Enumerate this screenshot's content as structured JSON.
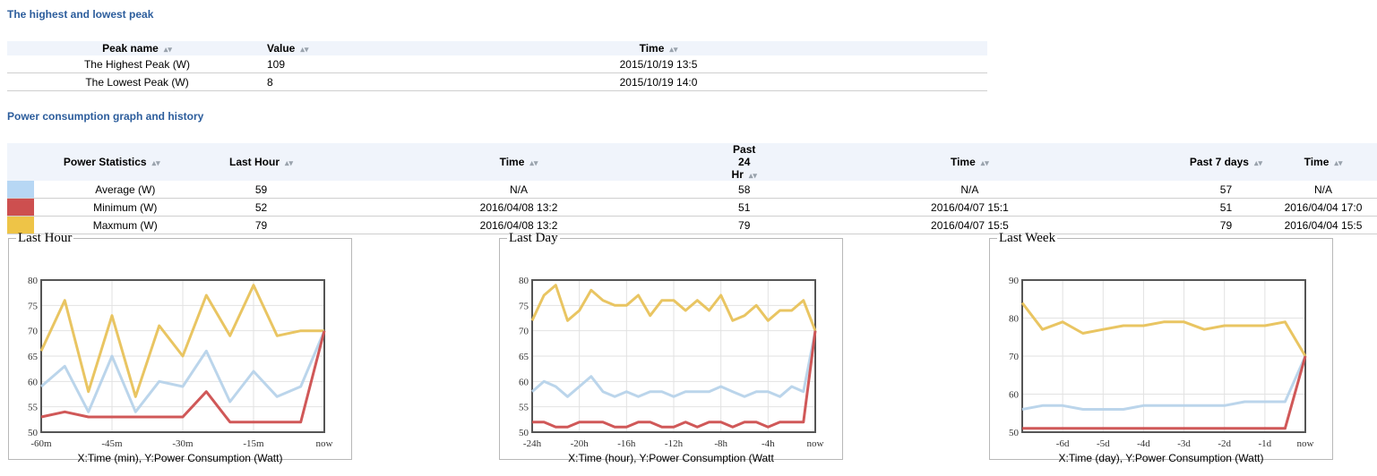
{
  "peak_section": {
    "title": "The highest and lowest peak",
    "headers": [
      "Peak name",
      "Value",
      "Time"
    ],
    "rows": [
      {
        "name": "The Highest Peak (W)",
        "value": "109",
        "time": "2015/10/19 13:5"
      },
      {
        "name": "The Lowest Peak (W)",
        "value": "8",
        "time": "2015/10/19 14:0"
      }
    ]
  },
  "power_section": {
    "title": "Power consumption graph and history",
    "headers": [
      "Power Statistics",
      "Last Hour",
      "Time",
      "Past 24 Hr",
      "Time",
      "Past 7 days",
      "Time"
    ],
    "rows": [
      {
        "swatch": "#b7d7f4",
        "label": "Average (W)",
        "cells": [
          "59",
          "N/A",
          "58",
          "N/A",
          "57",
          "N/A"
        ]
      },
      {
        "swatch": "#cd4f4f",
        "label": "Minimum (W)",
        "cells": [
          "52",
          "2016/04/08 13:2",
          "51",
          "2016/04/07 15:1",
          "51",
          "2016/04/04 17:0"
        ]
      },
      {
        "swatch": "#eec447",
        "label": "Maxmum (W)",
        "cells": [
          "79",
          "2016/04/08 13:2",
          "79",
          "2016/04/07 15:5",
          "79",
          "2016/04/04 15:5"
        ]
      }
    ]
  },
  "colors": {
    "average": "#b7d3ea",
    "minimum": "#cd4f4f",
    "maximum": "#e8c25a"
  },
  "chart_data": [
    {
      "type": "line",
      "title": "Last Hour",
      "xlabel": "X:Time (min), Y:Power Consumption (Watt)",
      "x_ticks": [
        "-60m",
        "-45m",
        "-30m",
        "-15m",
        "now"
      ],
      "y_ticks": [
        "50",
        "55",
        "60",
        "65",
        "70",
        "75",
        "80"
      ],
      "ylim": [
        50,
        80
      ],
      "grid": true,
      "x": [
        -60,
        -55,
        -50,
        -45,
        -40,
        -35,
        -30,
        -25,
        -20,
        -15,
        -10,
        -5,
        0
      ],
      "series": [
        {
          "key": "maximum",
          "values": [
            66,
            76,
            58,
            73,
            57,
            71,
            65,
            77,
            69,
            79,
            69,
            70,
            70
          ]
        },
        {
          "key": "average",
          "values": [
            59,
            63,
            54,
            65,
            54,
            60,
            59,
            66,
            56,
            62,
            57,
            59,
            70
          ]
        },
        {
          "key": "minimum",
          "values": [
            53,
            54,
            53,
            53,
            53,
            53,
            53,
            58,
            52,
            52,
            52,
            52,
            70
          ]
        }
      ]
    },
    {
      "type": "line",
      "title": "Last Day",
      "xlabel": "X:Time (hour), Y:Power Consumption (Watt",
      "x_ticks": [
        "-24h",
        "-20h",
        "-16h",
        "-12h",
        "-8h",
        "-4h",
        "now"
      ],
      "y_ticks": [
        "50",
        "55",
        "60",
        "65",
        "70",
        "75",
        "80"
      ],
      "ylim": [
        50,
        80
      ],
      "grid": true,
      "x": [
        -24,
        -23,
        -22,
        -21,
        -20,
        -19,
        -18,
        -17,
        -16,
        -15,
        -14,
        -13,
        -12,
        -11,
        -10,
        -9,
        -8,
        -7,
        -6,
        -5,
        -4,
        -3,
        -2,
        -1,
        0
      ],
      "series": [
        {
          "key": "maximum",
          "values": [
            72,
            77,
            79,
            72,
            74,
            78,
            76,
            75,
            75,
            77,
            73,
            76,
            76,
            74,
            76,
            74,
            77,
            72,
            73,
            75,
            72,
            74,
            74,
            76,
            70
          ]
        },
        {
          "key": "average",
          "values": [
            58,
            60,
            59,
            57,
            59,
            61,
            58,
            57,
            58,
            57,
            58,
            58,
            57,
            58,
            58,
            58,
            59,
            58,
            57,
            58,
            58,
            57,
            59,
            58,
            70
          ]
        },
        {
          "key": "minimum",
          "values": [
            52,
            52,
            51,
            51,
            52,
            52,
            52,
            51,
            51,
            52,
            52,
            51,
            51,
            52,
            51,
            52,
            52,
            51,
            52,
            52,
            51,
            52,
            52,
            52,
            70
          ]
        }
      ]
    },
    {
      "type": "line",
      "title": "Last Week",
      "xlabel": "X:Time (day), Y:Power Consumption (Watt)",
      "x_ticks": [
        "-6d",
        "-5d",
        "-4d",
        "-3d",
        "-2d",
        "-1d",
        "now"
      ],
      "x_tick_values": [
        -6,
        -5,
        -4,
        -3,
        -2,
        -1,
        0
      ],
      "y_ticks": [
        "50",
        "60",
        "70",
        "80",
        "90"
      ],
      "ylim": [
        50,
        90
      ],
      "xlim": [
        -7,
        0
      ],
      "grid": true,
      "x": [
        -7,
        -6.667,
        -6.333,
        -6,
        -5.667,
        -5.333,
        -5,
        -4.667,
        -4.333,
        -4,
        -3.667,
        -3.333,
        -3,
        -2.667,
        -2.333,
        -2,
        -1.667,
        -1.333,
        -1,
        -0.667,
        -0.333,
        0
      ],
      "series": [
        {
          "key": "maximum",
          "values": [
            84,
            77,
            79,
            76,
            77,
            78,
            78,
            79,
            79,
            77,
            78,
            78,
            78,
            79,
            70
          ]
        },
        {
          "key": "average",
          "values": [
            56,
            57,
            57,
            56,
            56,
            56,
            57,
            57,
            57,
            57,
            57,
            58,
            58,
            58,
            70
          ]
        },
        {
          "key": "minimum",
          "values": [
            51,
            51,
            51,
            51,
            51,
            51,
            51,
            51,
            51,
            51,
            51,
            51,
            51,
            51,
            70
          ]
        }
      ],
      "series_x": [
        -7,
        -6.5,
        -6,
        -5.5,
        -5,
        -4.5,
        -4,
        -3.5,
        -3,
        -2.5,
        -2,
        -1.5,
        -1,
        -0.5,
        0
      ]
    }
  ]
}
